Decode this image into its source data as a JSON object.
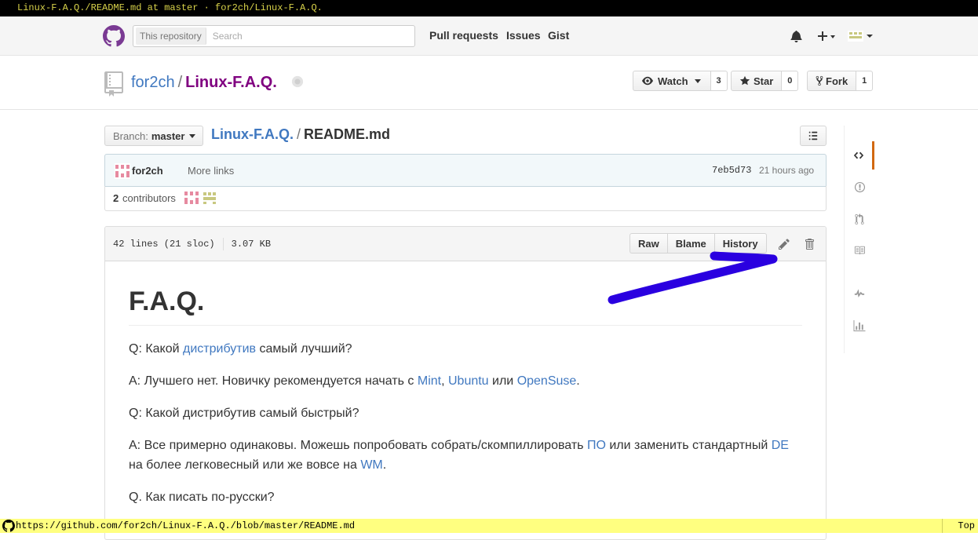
{
  "browser": {
    "title": "Linux-F.A.Q./README.md at master · for2ch/Linux-F.A.Q.",
    "status_url": "https://github.com/for2ch/Linux-F.A.Q./blob/master/README.md",
    "status_position": "Top"
  },
  "header": {
    "search_scope": "This repository",
    "search_placeholder": "Search",
    "nav": [
      "Pull requests",
      "Issues",
      "Gist"
    ]
  },
  "repo": {
    "owner": "for2ch",
    "separator": "/",
    "name": "Linux-F.A.Q.",
    "watch": {
      "label": "Watch",
      "count": "3"
    },
    "star": {
      "label": "Star",
      "count": "0"
    },
    "fork": {
      "label": "Fork",
      "count": "1"
    }
  },
  "file_nav": {
    "branch_label": "Branch:",
    "branch_value": "master",
    "breadcrumb_repo": "Linux-F.A.Q.",
    "breadcrumb_sep": "/",
    "breadcrumb_file": "README.md"
  },
  "commit": {
    "author": "for2ch",
    "message": "More links",
    "sha": "7eb5d73",
    "time": "21 hours ago",
    "contributors_count": "2",
    "contributors_label": "contributors"
  },
  "file": {
    "lines": "42 lines (21 sloc)",
    "size": "3.07 KB",
    "buttons": {
      "raw": "Raw",
      "blame": "Blame",
      "history": "History"
    }
  },
  "readme": {
    "title": "F.A.Q.",
    "q1": {
      "prefix": "Q: Какой ",
      "link": "дистрибутив",
      "suffix": " самый лучший?"
    },
    "a1": {
      "prefix": "А: Лучшего нет. Новичку рекомендуется начать с ",
      "link1": "Mint",
      "sep1": ", ",
      "link2": "Ubuntu",
      "sep2": " или ",
      "link3": "OpenSuse",
      "suffix": "."
    },
    "q2": "Q: Какой дистрибутив самый быстрый?",
    "a2": {
      "prefix": "A: Все примерно одинаковы. Можешь попробовать собрать/скомпиллировать ",
      "link1": "ПО",
      "mid1": " или заменить стандартный ",
      "link2": "DE",
      "mid2": " на более легковесный или же вовсе на ",
      "link3": "WM",
      "suffix": "."
    },
    "q3": "Q. Как писать по-русски?"
  },
  "colors": {
    "link": "#4078c0",
    "repo_name": "#800080",
    "annotation": "#2a00e0",
    "status_bar": "#ffff80"
  }
}
